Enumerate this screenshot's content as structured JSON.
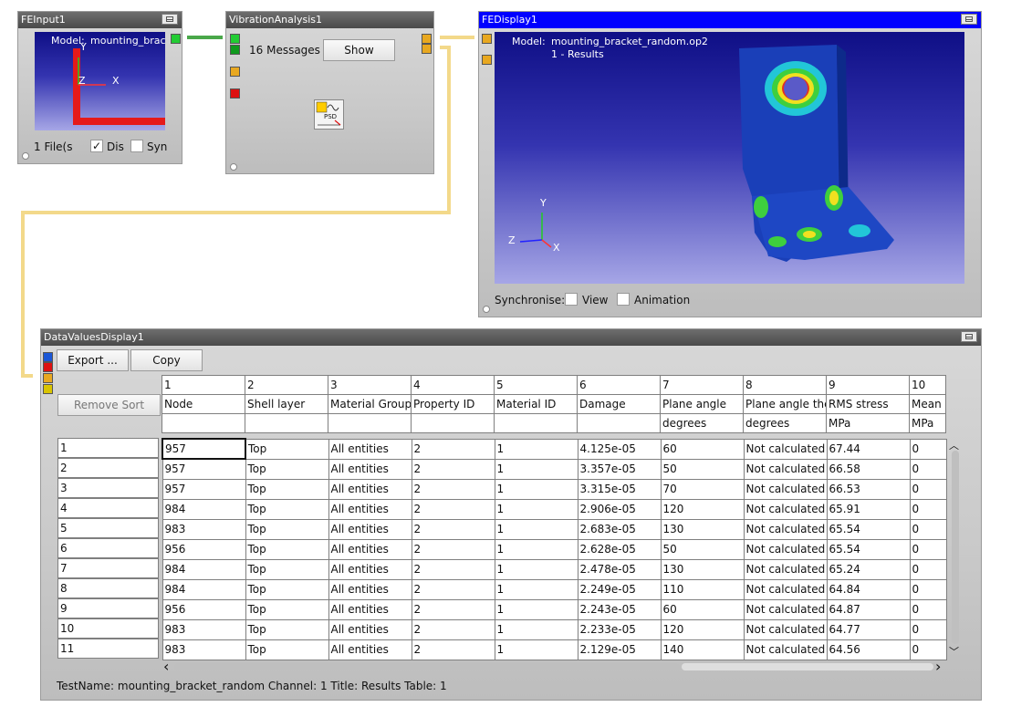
{
  "fe_input": {
    "title": "FEInput1",
    "model_label": "Model:",
    "model_name": "mounting_bracke",
    "files_label": "1 File(s",
    "display_label": "Dis",
    "display_checked": "✓",
    "sync_label": "Syn",
    "axis_y": "Y",
    "axis_z": "Z",
    "axis_x": "X"
  },
  "vibration": {
    "title": "VibrationAnalysis1",
    "messages": "16 Messages",
    "show_button": "Show",
    "icon_text": "PSD"
  },
  "fe_display": {
    "title": "FEDisplay1",
    "model_label": "Model:",
    "model_name": "mounting_bracket_random.op2",
    "results_line": "1 - Results",
    "synchronise_label": "Synchronise:",
    "view_label": "View",
    "animation_label": "Animation",
    "axis_y": "Y",
    "axis_z": "Z",
    "axis_x": "X"
  },
  "data_values": {
    "title": "DataValuesDisplay1",
    "export_button": "Export ...",
    "copy_button": "Copy",
    "remove_sort_button": "Remove Sort",
    "column_numbers": [
      "1",
      "2",
      "3",
      "4",
      "5",
      "6",
      "7",
      "8",
      "9",
      "10"
    ],
    "column_names": [
      "Node",
      "Shell layer",
      "Material Group",
      "Property ID",
      "Material ID",
      "Damage",
      "Plane angle",
      "Plane angle the",
      "RMS stress",
      "Mean s"
    ],
    "column_units": [
      "",
      "",
      "",
      "",
      "",
      "",
      "degrees",
      "degrees",
      "MPa",
      "MPa"
    ],
    "rows": [
      {
        "index": "1",
        "cells": [
          "957",
          "Top",
          "All entities",
          "2",
          "1",
          "4.125e-05",
          "60",
          "Not calculated",
          "67.44",
          "0"
        ]
      },
      {
        "index": "2",
        "cells": [
          "957",
          "Top",
          "All entities",
          "2",
          "1",
          "3.357e-05",
          "50",
          "Not calculated",
          "66.58",
          "0"
        ]
      },
      {
        "index": "3",
        "cells": [
          "957",
          "Top",
          "All entities",
          "2",
          "1",
          "3.315e-05",
          "70",
          "Not calculated",
          "66.53",
          "0"
        ]
      },
      {
        "index": "4",
        "cells": [
          "984",
          "Top",
          "All entities",
          "2",
          "1",
          "2.906e-05",
          "120",
          "Not calculated",
          "65.91",
          "0"
        ]
      },
      {
        "index": "5",
        "cells": [
          "983",
          "Top",
          "All entities",
          "2",
          "1",
          "2.683e-05",
          "130",
          "Not calculated",
          "65.54",
          "0"
        ]
      },
      {
        "index": "6",
        "cells": [
          "956",
          "Top",
          "All entities",
          "2",
          "1",
          "2.628e-05",
          "50",
          "Not calculated",
          "65.54",
          "0"
        ]
      },
      {
        "index": "7",
        "cells": [
          "984",
          "Top",
          "All entities",
          "2",
          "1",
          "2.478e-05",
          "130",
          "Not calculated",
          "65.24",
          "0"
        ]
      },
      {
        "index": "8",
        "cells": [
          "984",
          "Top",
          "All entities",
          "2",
          "1",
          "2.249e-05",
          "110",
          "Not calculated",
          "64.84",
          "0"
        ]
      },
      {
        "index": "9",
        "cells": [
          "956",
          "Top",
          "All entities",
          "2",
          "1",
          "2.243e-05",
          "60",
          "Not calculated",
          "64.87",
          "0"
        ]
      },
      {
        "index": "10",
        "cells": [
          "983",
          "Top",
          "All entities",
          "2",
          "1",
          "2.233e-05",
          "120",
          "Not calculated",
          "64.77",
          "0"
        ]
      },
      {
        "index": "11",
        "cells": [
          "983",
          "Top",
          "All entities",
          "2",
          "1",
          "2.129e-05",
          "140",
          "Not calculated",
          "64.56",
          "0"
        ]
      }
    ],
    "status_line": "TestName: mounting_bracket_random  Channel: 1  Title: Results  Table: 1",
    "scroll_up": "︿",
    "scroll_down": "﹀",
    "scroll_left": "‹",
    "scroll_right": "›"
  },
  "colors": {
    "active_title": "#0000ff",
    "inactive_title": "#555555",
    "connector_green": "#4aa84a",
    "connector_yellow": "#f3d98a"
  }
}
